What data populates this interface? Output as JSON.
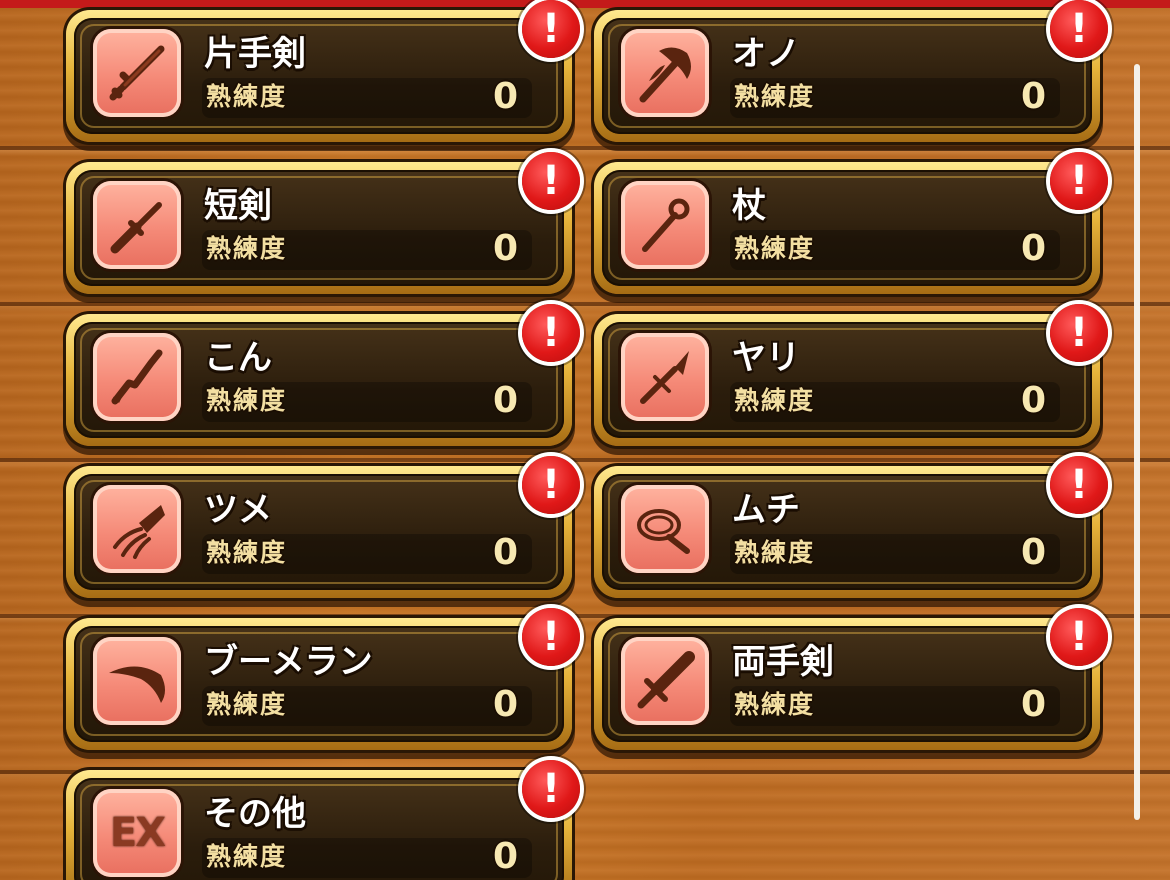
{
  "level_label": "熟練度",
  "alert_mark": "!",
  "colors": {
    "top_bar": "#c41a1a",
    "wood": "#c46f23",
    "card_gold": "#e6b33a",
    "icon_bg": "#f58a78",
    "alert": "#e01818"
  },
  "weapons": [
    {
      "name": "片手剣",
      "level": "0",
      "icon": "one-handed-sword-icon",
      "alert": true
    },
    {
      "name": "オノ",
      "level": "0",
      "icon": "axe-icon",
      "alert": true
    },
    {
      "name": "短剣",
      "level": "0",
      "icon": "dagger-icon",
      "alert": true
    },
    {
      "name": "杖",
      "level": "0",
      "icon": "staff-icon",
      "alert": true
    },
    {
      "name": "こん",
      "level": "0",
      "icon": "club-icon",
      "alert": true
    },
    {
      "name": "ヤリ",
      "level": "0",
      "icon": "spear-icon",
      "alert": true
    },
    {
      "name": "ツメ",
      "level": "0",
      "icon": "claw-icon",
      "alert": true
    },
    {
      "name": "ムチ",
      "level": "0",
      "icon": "whip-icon",
      "alert": true
    },
    {
      "name": "ブーメラン",
      "level": "0",
      "icon": "boomerang-icon",
      "alert": true
    },
    {
      "name": "両手剣",
      "level": "0",
      "icon": "two-handed-sword-icon",
      "alert": true
    },
    {
      "name": "その他",
      "level": "0",
      "icon": "ex-icon",
      "icon_text": "EX",
      "alert": true
    }
  ]
}
